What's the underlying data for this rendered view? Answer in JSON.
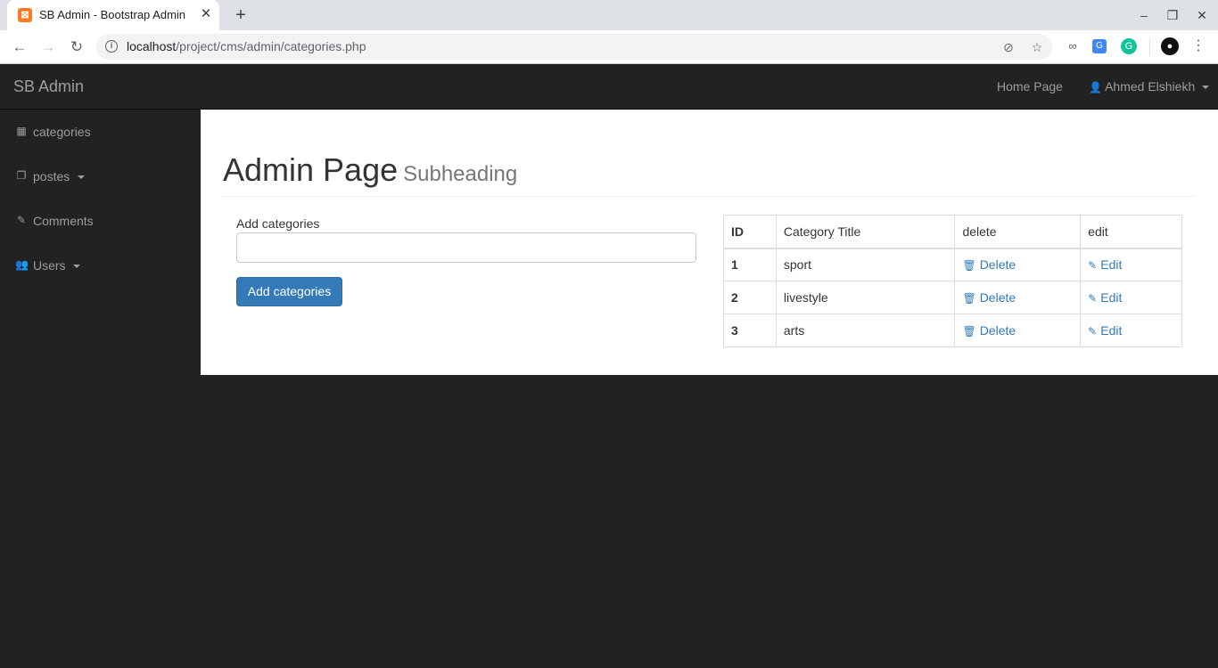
{
  "browser": {
    "tab_title": "SB Admin - Bootstrap Admin",
    "favicon_glyph": "⊠",
    "url_host": "localhost",
    "url_path": "/project/cms/admin/categories.php"
  },
  "topnav": {
    "brand": "SB Admin",
    "home_link": "Home Page",
    "user_name": "Ahmed Elshiekh"
  },
  "sidebar": {
    "items": [
      {
        "label": "categories",
        "icon": "table-icon"
      },
      {
        "label": "postes",
        "icon": "files-icon"
      },
      {
        "label": "Comments",
        "icon": "edit-icon"
      },
      {
        "label": "Users",
        "icon": "users-icon"
      }
    ]
  },
  "main": {
    "title": "Admin Page",
    "subtitle": "Subheading",
    "form": {
      "label": "Add categories",
      "input_value": "",
      "button_label": "Add categories"
    },
    "table": {
      "headers": [
        "ID",
        "Category Title",
        "delete",
        "edit"
      ],
      "rows": [
        {
          "id": "1",
          "title": "sport",
          "delete": "Delete",
          "edit": "Edit"
        },
        {
          "id": "2",
          "title": "livestyle",
          "delete": "Delete",
          "edit": "Edit"
        },
        {
          "id": "3",
          "title": "arts",
          "delete": "Delete",
          "edit": "Edit"
        }
      ]
    }
  },
  "colors": {
    "navbar_bg": "#222222",
    "link": "#337ab7",
    "primary_button": "#337ab7"
  }
}
